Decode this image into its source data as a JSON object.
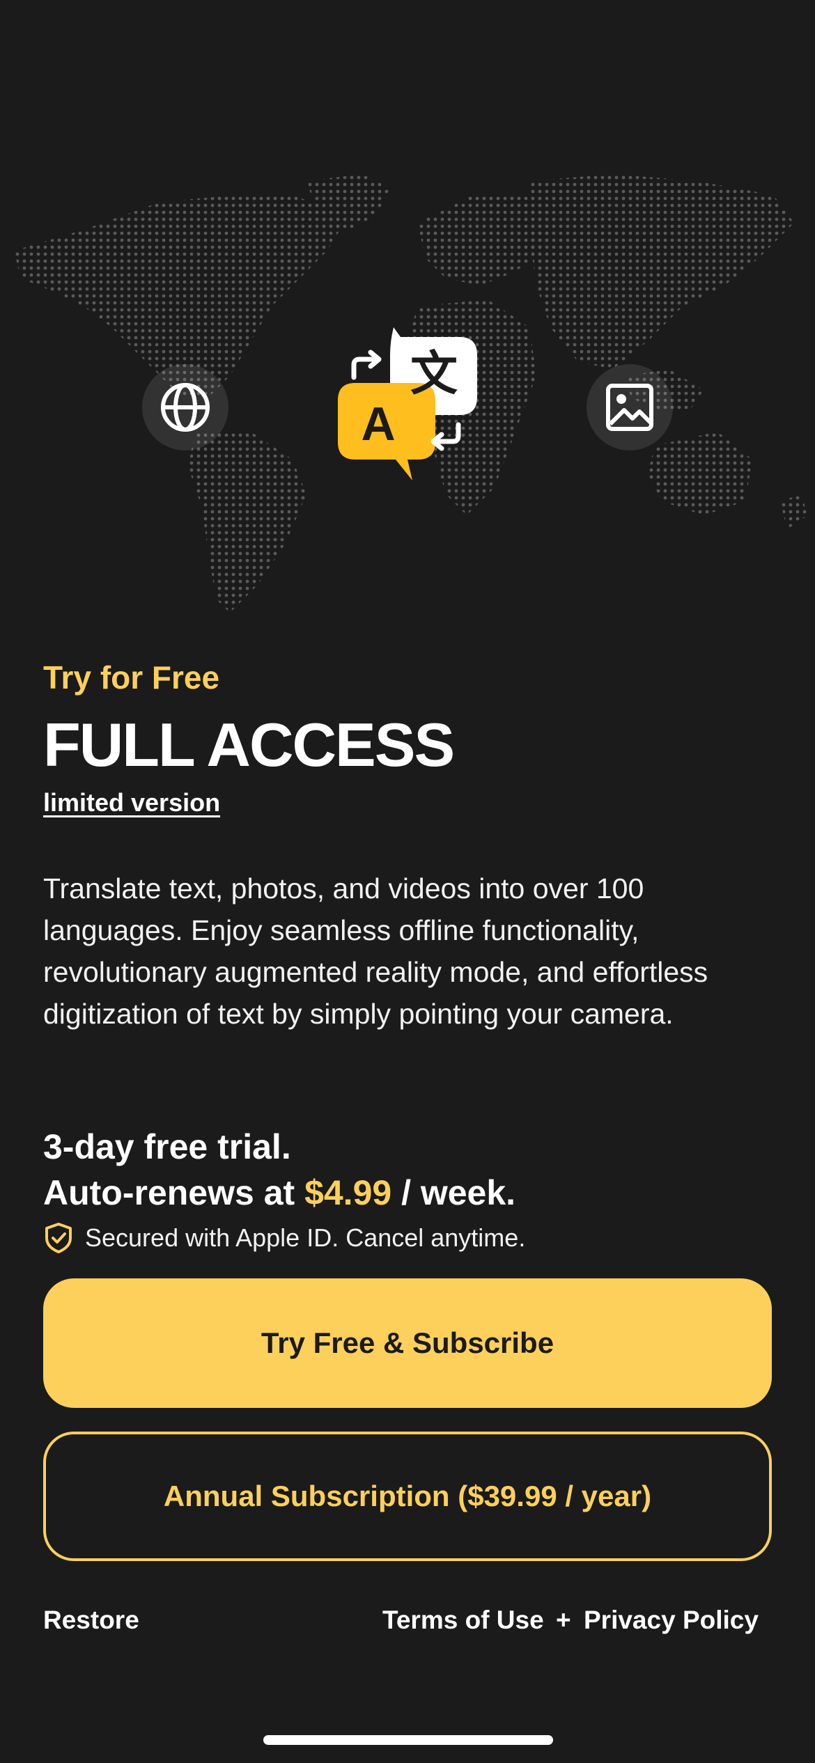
{
  "hero": {
    "logo_glyph_latin": "A",
    "logo_glyph_cjk": "文",
    "left_feature_icon": "globe-icon",
    "right_feature_icon": "image-icon"
  },
  "offer": {
    "eyebrow": "Try for Free",
    "headline": "FULL ACCESS",
    "limited_link": "limited version",
    "description": "Translate text, photos, and videos into over 100 languages. Enjoy seamless offline functionality, revolutionary augmented reality mode, and effortless digitization of text by simply pointing your camera.",
    "trial_line": "3-day free trial.",
    "renew_prefix": "Auto-renews at ",
    "renew_price": "$4.99",
    "renew_suffix": " / week.",
    "secured_text": "Secured with Apple ID. Cancel anytime."
  },
  "buttons": {
    "primary_label": "Try Free & Subscribe",
    "secondary_label": "Annual Subscription ($39.99 / year)"
  },
  "footer": {
    "restore_label": "Restore",
    "terms_label": "Terms of Use",
    "separator": "+",
    "privacy_label": "Privacy Policy"
  },
  "colors": {
    "background": "#1b1b1b",
    "accent": "#fdd05b",
    "text": "#ffffff"
  }
}
